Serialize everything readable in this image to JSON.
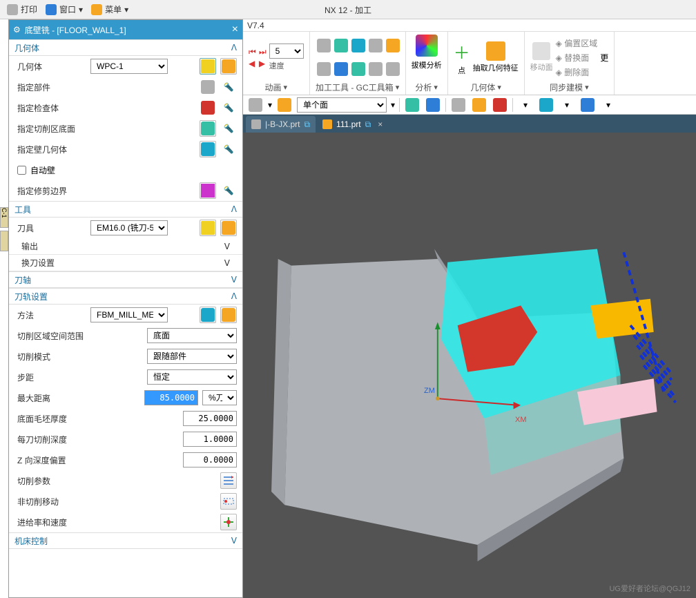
{
  "appTitle": "NX 12 - 加工",
  "version": "V7.4",
  "topMenu": {
    "print": "打印",
    "window": "窗口",
    "menu": "菜单"
  },
  "dialog": {
    "title": "底壁铣 - [FLOOR_WALL_1]",
    "sections": {
      "geom": "几何体",
      "tool": "工具",
      "output": "输出",
      "toolchange": "换刀设置",
      "axis": "刀轴",
      "path": "刀轨设置",
      "mc": "机床控制"
    },
    "labels": {
      "geomBody": "几何体",
      "specPart": "指定部件",
      "specCheck": "指定检查体",
      "specCutFloor": "指定切削区底面",
      "specWall": "指定壁几何体",
      "autoWall": "自动壁",
      "specTrim": "指定修剪边界",
      "tool": "刀具",
      "method": "方法",
      "cutSpace": "切削区域空间范围",
      "cutMode": "切削模式",
      "step": "步距",
      "maxDist": "最大距离",
      "floorBlank": "底面毛坯厚度",
      "perCut": "每刀切削深度",
      "zOffset": "Z 向深度偏置",
      "cutParam": "切削参数",
      "nonCut": "非切削移动",
      "feed": "进给率和速度"
    },
    "values": {
      "geom": "WPC-1",
      "tool": "EM16.0 (铣刀-5",
      "method": "FBM_MILL_METH",
      "cutSpace": "底面",
      "cutMode": "跟随部件",
      "step": "恒定",
      "maxDist": "85.0000",
      "maxDistUnit": "%刀具",
      "floorBlank": "25.0000",
      "perCut": "1.0000",
      "zOffset": "0.0000"
    }
  },
  "ribbon": {
    "speedVal": "5",
    "groups": {
      "anim": "动画",
      "speed": "速度",
      "gc": "加工工具 - GC工具箱",
      "analysis": "分析",
      "draft": "拔模分析",
      "point": "点",
      "extract": "抽取几何特征",
      "geom": "几何体",
      "move": "移动面",
      "offset": "偏置区域",
      "replace": "替换面",
      "delete": "删除面",
      "sync": "同步建模",
      "more": "更"
    }
  },
  "toolbar2": {
    "opt": "单个面"
  },
  "tabs": {
    "t1": "|-B-JX.prt",
    "t2": "111.prt"
  },
  "axes": {
    "x": "XM",
    "z": "ZM"
  },
  "watermark": "UG爱好者论坛@QGJ12"
}
